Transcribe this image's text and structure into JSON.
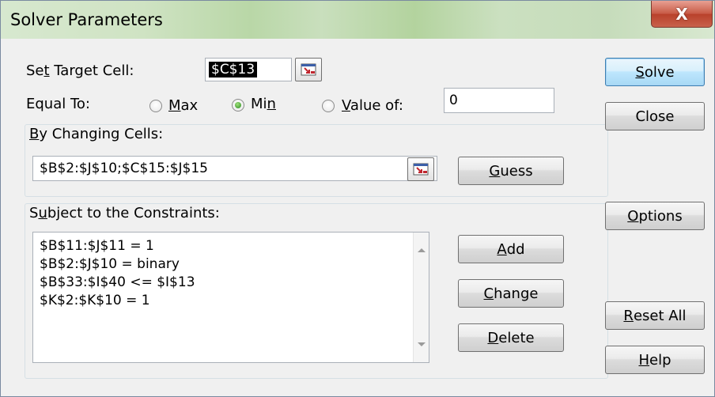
{
  "window": {
    "title": "Solver Parameters",
    "close_glyph": "X"
  },
  "target": {
    "label_pre": "Se",
    "label_key": "t",
    "label_post": " Target Cell:",
    "value": "$C$13"
  },
  "equal_to": {
    "label": "Equal To:",
    "max": {
      "key": "M",
      "rest": "ax",
      "checked": false
    },
    "min": {
      "pre": "Mi",
      "key": "n",
      "checked": true
    },
    "value_of": {
      "key": "V",
      "rest": "alue of:",
      "checked": false
    },
    "value": "0"
  },
  "changing": {
    "label_key": "B",
    "label_rest": "y Changing Cells:",
    "value": "$B$2:$J$10;$C$15:$J$15"
  },
  "constraints": {
    "label_key": "u",
    "label_pre": "S",
    "label_rest": "bject to the Constraints:",
    "items": [
      "$B$11:$J$11 = 1",
      "$B$2:$J$10 = binary",
      "$B$33:$I$40 <= $I$13",
      "$K$2:$K$10 = 1"
    ]
  },
  "buttons": {
    "solve": {
      "key": "S",
      "rest": "olve"
    },
    "close": {
      "label": "Close"
    },
    "guess": {
      "key": "G",
      "rest": "uess"
    },
    "options": {
      "key": "O",
      "rest": "ptions"
    },
    "add": {
      "key": "A",
      "rest": "dd"
    },
    "change": {
      "key": "C",
      "rest": "hange"
    },
    "delete": {
      "key": "D",
      "rest": "elete"
    },
    "reset_all": {
      "key": "R",
      "rest": "eset All"
    },
    "help": {
      "key": "H",
      "rest": "elp"
    }
  },
  "icons": {
    "close": "close-icon",
    "range_picker": "collapse-dialog-icon",
    "scroll_up": "scroll-up-arrow-icon",
    "scroll_down": "scroll-down-arrow-icon"
  }
}
